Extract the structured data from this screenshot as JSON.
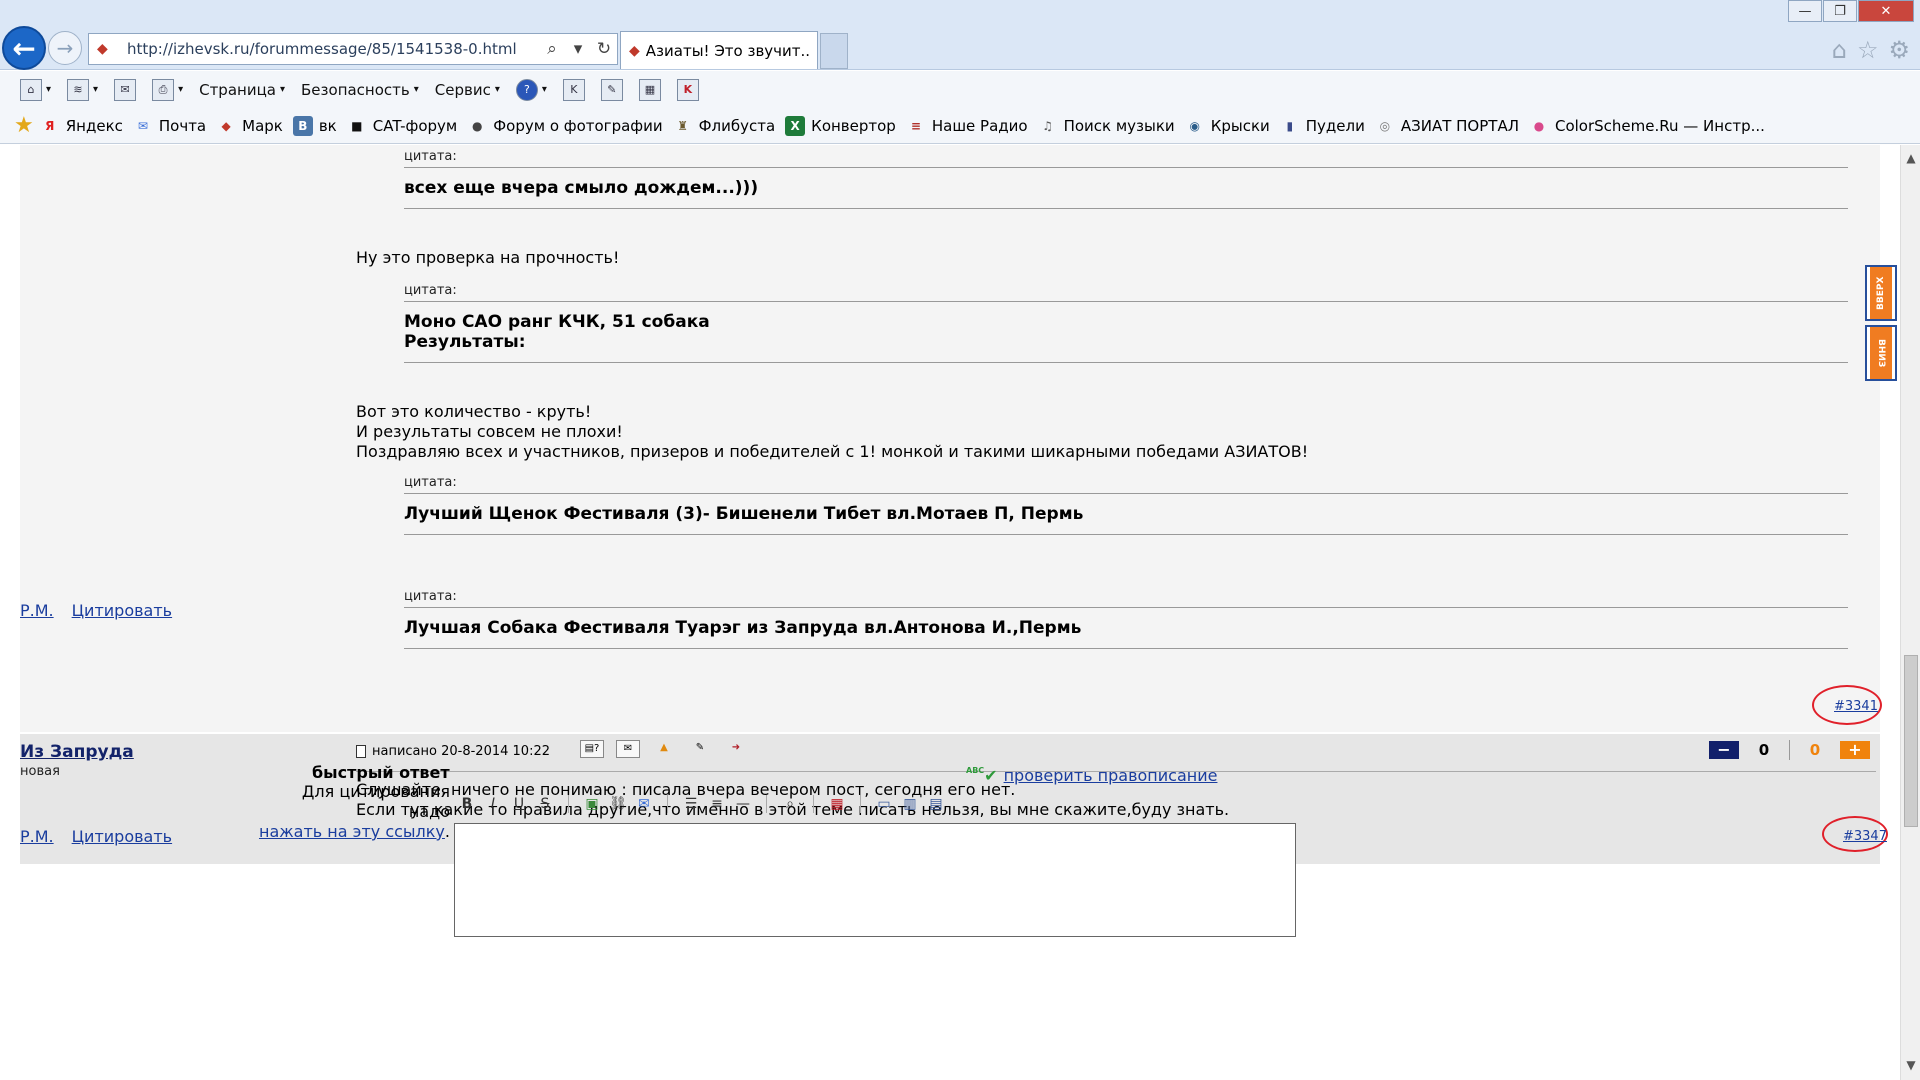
{
  "browser": {
    "url": "http://izhevsk.ru/forummessage/85/1541538-0.html",
    "tab_title": "Азиаты! Это звучит...",
    "window_controls": {
      "minimize": "—",
      "maximize": "❐",
      "close": "✕"
    },
    "command_bar": [
      {
        "label": "Страница",
        "caret": "▾"
      },
      {
        "label": "Безопасность",
        "caret": "▾"
      },
      {
        "label": "Сервис",
        "caret": "▾"
      }
    ],
    "favorites": [
      {
        "label": "Яндекс",
        "icon": "Я",
        "color": "#e02020"
      },
      {
        "label": "Почта",
        "icon": "✉",
        "color": "#3a6fd8"
      },
      {
        "label": "Марк",
        "icon": "◆",
        "color": "#c0392b"
      },
      {
        "label": "вк",
        "icon": "B",
        "color": "#4a76a8"
      },
      {
        "label": "CAT-форум",
        "icon": "■",
        "color": "#111111"
      },
      {
        "label": "Форум о фотографии",
        "icon": "●",
        "color": "#444444"
      },
      {
        "label": "Флибуста",
        "icon": "♜",
        "color": "#6b5a2e"
      },
      {
        "label": "Конвертор",
        "icon": "X",
        "color": "#1e7b3a"
      },
      {
        "label": "Наше Радио",
        "icon": "≡",
        "color": "#b0302a"
      },
      {
        "label": "Поиск музыки",
        "icon": "♫",
        "color": "#555555"
      },
      {
        "label": "Крыски",
        "icon": "◉",
        "color": "#2a5d8a"
      },
      {
        "label": "Пудели",
        "icon": "▮",
        "color": "#3a4b8a"
      },
      {
        "label": "АЗИАТ ПОРТАЛ",
        "icon": "◎",
        "color": "#777777"
      },
      {
        "label": "ColorScheme.Ru — Инстр...",
        "icon": "●",
        "color": "#d94a8c"
      }
    ]
  },
  "post1": {
    "quotes": [
      {
        "label": "цитата:",
        "lines": [
          "всех еще вчера смыло дождем...)))"
        ]
      },
      {
        "label": "цитата:",
        "lines": [
          "Моно САО ранг КЧК, 51 собака",
          "Результаты:"
        ]
      },
      {
        "label": "цитата:",
        "lines": [
          "Лучший Щенок Фестиваля (3)- Бишенели Тибет вл.Мотаев П, Пермь"
        ]
      },
      {
        "label": "цитата:",
        "lines": [
          "Лучшая Собака Фестиваля Туарэг из Запруда вл.Антонова И.,Пермь"
        ]
      }
    ],
    "text1": "Ну это проверка на прочность!",
    "text2": [
      "Вот это количество - круть!",
      "И результаты совсем не плохи!",
      "Поздравляю всех и участников, призеров и победителей с 1! монкой и такими шикарными победами АЗИАТОВ!"
    ],
    "pm_link": "Р.М.",
    "quote_link": "Цитировать",
    "post_number": "#3341"
  },
  "post2": {
    "author": "Из Запруда",
    "role": "новая",
    "meta": "написано 20-8-2014 10:22",
    "rating_minus": "−",
    "rating_neg": "0",
    "rating_pos": "0",
    "rating_plus": "+",
    "lines": [
      "Слушайте, ничего не понимаю : писала вчера вечером пост, сегодня его нет.",
      "Если тут какие то правила другие,что именно в этой теме писать нельзя, вы мне скажите,буду знать."
    ],
    "pm_link": "Р.М.",
    "quote_link": "Цитировать",
    "post_number": "#3347"
  },
  "scroll_buttons": {
    "up": "ВВЕРХ",
    "down": "ВНИЗ"
  },
  "quick_reply": {
    "title": "быстрый ответ",
    "hint": "Для цитирования надо",
    "hint_link": "нажать на эту ссылку",
    "spell_label": "ABC",
    "spell_check": "проверить правописание"
  }
}
